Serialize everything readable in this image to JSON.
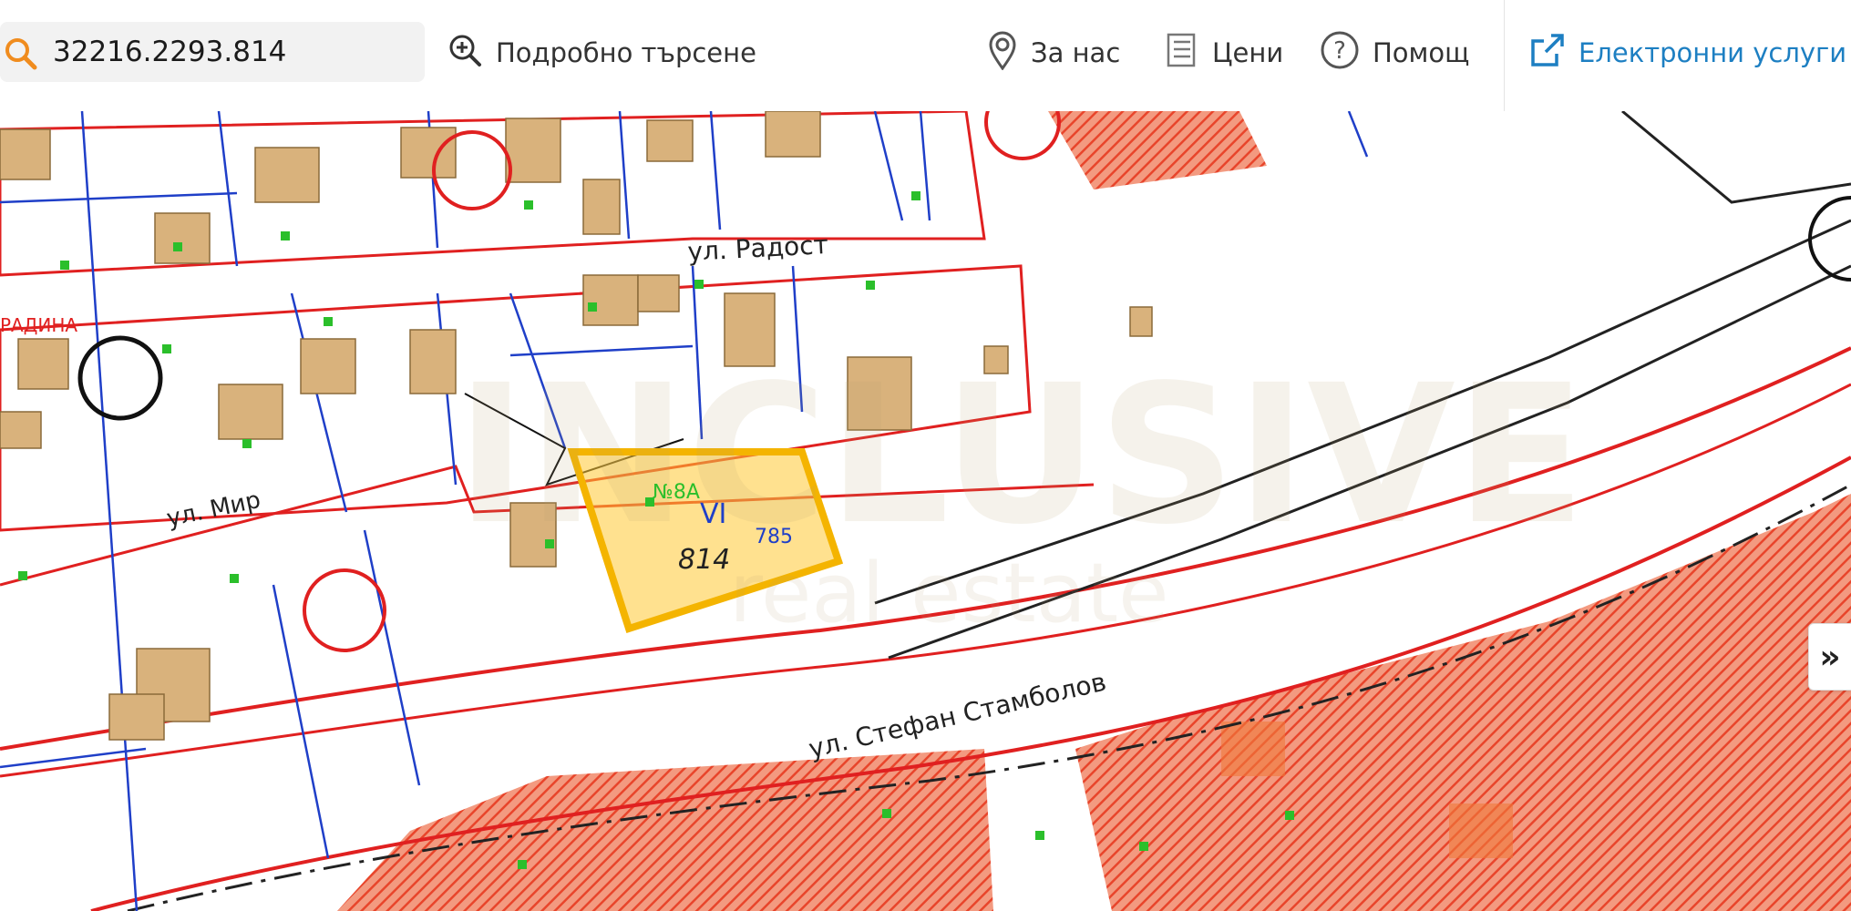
{
  "search": {
    "value": "32216.2293.814"
  },
  "nav": {
    "advanced_search": "Подробно търсене",
    "about": "За нас",
    "prices": "Цени",
    "help": "Помощ",
    "eservices": "Електронни услуги"
  },
  "map": {
    "streets": {
      "radost": "ул. Радост",
      "mir": "ул. Мир",
      "stambolov": "ул. Стефан Стамболов",
      "gradina_partial": "РАДИНА"
    },
    "highlight": {
      "parcel": "814",
      "roman": "VI",
      "ref": "785",
      "addr": "№8А"
    },
    "watermark": {
      "brand": "INCLUSIVE",
      "tagline": "real estate"
    },
    "expand_button": "»"
  },
  "colors": {
    "accent_orange": "#f08c1e",
    "link_blue": "#1d7fc2",
    "parcel_red": "#e02020",
    "boundary_blue": "#1f3fc8",
    "building_tan": "#d9b27c",
    "highlight_yellow": "#ffc933",
    "hatch_red": "#e8452b"
  }
}
